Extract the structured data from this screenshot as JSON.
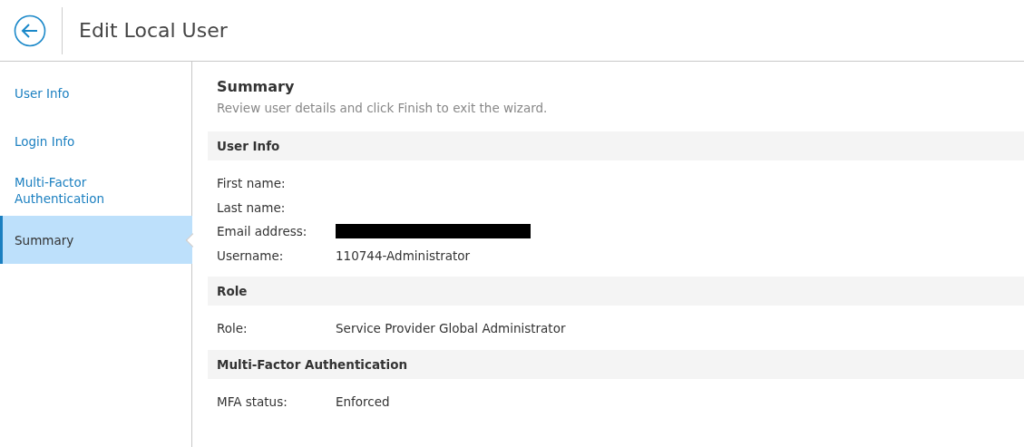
{
  "header": {
    "title": "Edit Local User"
  },
  "sidebar": {
    "items": [
      {
        "label": "User Info",
        "selected": false
      },
      {
        "label": "Login Info",
        "selected": false
      },
      {
        "label": "Multi-Factor Authentication",
        "selected": false
      },
      {
        "label": "Summary",
        "selected": true
      }
    ]
  },
  "content": {
    "title": "Summary",
    "subtitle": "Review user details and click Finish to exit the wizard.",
    "sections": [
      {
        "title": "User Info",
        "fields": [
          {
            "label": "First name:"
          },
          {
            "label": "Last name:"
          },
          {
            "label": "Email address:",
            "redacted": true
          },
          {
            "label": "Username:",
            "value": "110744-Administrator"
          }
        ]
      },
      {
        "title": "Role",
        "fields": [
          {
            "label": "Role:",
            "value": "Service Provider Global Administrator"
          }
        ]
      },
      {
        "title": "Multi-Factor Authentication",
        "fields": [
          {
            "label": "MFA status:",
            "value": "Enforced"
          }
        ]
      }
    ]
  }
}
